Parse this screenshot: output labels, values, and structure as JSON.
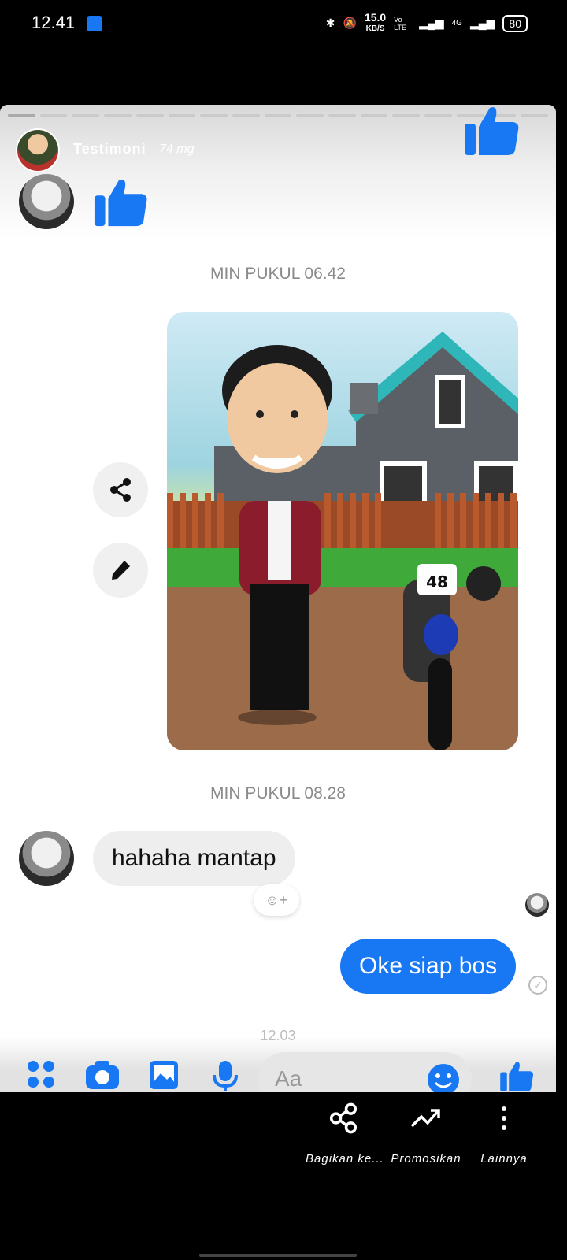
{
  "status_bar": {
    "time": "12.41",
    "net_speed_value": "15.0",
    "net_speed_unit": "KB/S",
    "volte_label": "Vo LTE",
    "network_label": "4G",
    "battery": "80"
  },
  "story": {
    "author_name": "Testimoni",
    "age": "74 mg",
    "progress_segments": 17,
    "active_segment": 1
  },
  "chat": {
    "timestamp_1": "MIN PUKUL 06.42",
    "timestamp_2": "MIN PUKUL 08.28",
    "incoming_message": "hahaha mantap",
    "outgoing_message": "Oke siap bos",
    "peek_time": "12.03",
    "input_placeholder": "Aa",
    "accent_color": "#1877f2",
    "photo_number": "48"
  },
  "actions": {
    "share_label": "Bagikan ke...",
    "promote_label": "Promosikan",
    "more_label": "Lainnya"
  }
}
